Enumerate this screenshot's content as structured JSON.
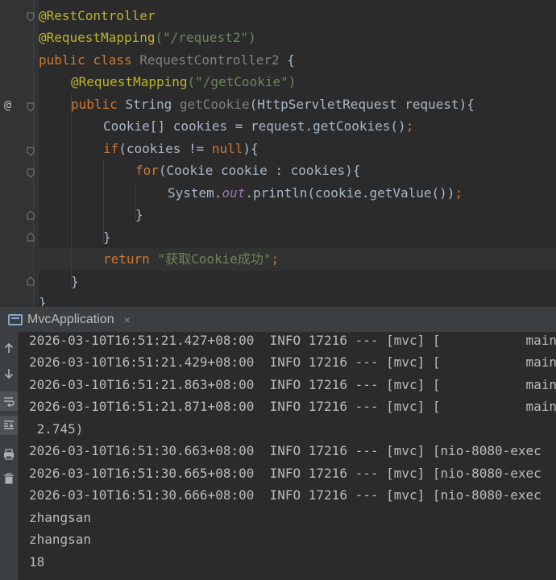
{
  "editor": {
    "lines": {
      "l1": "@RestController",
      "l2_ann": "@RequestMapping",
      "l2_arg": "(\"/request2\")",
      "l3_kw1": "public",
      "l3_kw2": "class",
      "l3_name": "RequestController2",
      "l3_brace": "{",
      "l4_ann": "@RequestMapping",
      "l4_arg": "(\"/getCookie\")",
      "l5_kw": "public",
      "l5_type": "String",
      "l5_name": "getCookie",
      "l5_params": "(HttpServletRequest request){",
      "l6_code": "Cookie[] cookies = request.getCookies()",
      "l6_semi": ";",
      "l7_kw": "if",
      "l7_a": "(cookies != ",
      "l7_null": "null",
      "l7_b": "){",
      "l8_kw": "for",
      "l8_a": "(Cookie cookie : cookies){",
      "l9_a": "System.",
      "l9_out": "out",
      "l9_b": ".println(cookie.getValue())",
      "l9_semi": ";",
      "l10": "}",
      "l11": "}",
      "l12_kw": "return",
      "l12_str": "\"获取Cookie成功\"",
      "l12_semi": ";",
      "l13": "}",
      "l14": "}"
    },
    "gutter_marker": "@"
  },
  "run_panel": {
    "tab_label": "MvcApplication",
    "close_glyph": "×"
  },
  "console": {
    "lines": [
      "2026-03-10T16:51:21.427+08:00  INFO 17216 --- [mvc] [           main",
      "2026-03-10T16:51:21.429+08:00  INFO 17216 --- [mvc] [           main",
      "2026-03-10T16:51:21.863+08:00  INFO 17216 --- [mvc] [           main",
      "2026-03-10T16:51:21.871+08:00  INFO 17216 --- [mvc] [           main",
      " 2.745)",
      "2026-03-10T16:51:30.663+08:00  INFO 17216 --- [mvc] [nio-8080-exec",
      "2026-03-10T16:51:30.665+08:00  INFO 17216 --- [mvc] [nio-8080-exec",
      "2026-03-10T16:51:30.666+08:00  INFO 17216 --- [mvc] [nio-8080-exec",
      "zhangsan",
      "zhangsan",
      "18"
    ]
  },
  "toolbar": {
    "up_icon": "up-arrow-icon",
    "down_icon": "down-arrow-icon",
    "wrap_icon": "soft-wrap-icon",
    "scroll_end_icon": "scroll-to-end-icon",
    "print_icon": "print-icon",
    "clear_icon": "trash-icon"
  },
  "colors": {
    "background": "#2b2b2b",
    "annotation": "#bbb529",
    "keyword": "#cc7832",
    "string": "#6a8759",
    "static_field": "#9876aa",
    "text": "#a9b7c6"
  }
}
